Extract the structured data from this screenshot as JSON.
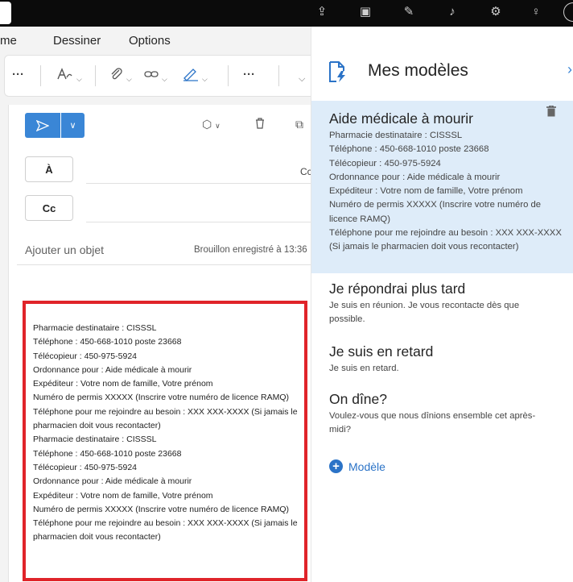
{
  "menu": {
    "home_partial": "me",
    "draw": "Dessiner",
    "options": "Options"
  },
  "ribbon": {
    "more1": "···",
    "more2": "···"
  },
  "compose": {
    "to_label": "À",
    "cc_label": "Cc",
    "cc_right_label": "Cc",
    "subject_placeholder": "Ajouter un objet",
    "draft_status": "Brouillon enregistré à 13:36",
    "body_lines": [
      "Pharmacie destinataire : CISSSL",
      "Téléphone : 450-668-1010 poste 23668",
      "Télécopieur : 450-975-5924",
      "Ordonnance pour : Aide médicale à mourir",
      "Expéditeur : Votre nom de famille, Votre prénom",
      "Numéro de permis XXXXX (Inscrire votre numéro de licence RAMQ)",
      "Téléphone pour me rejoindre au besoin : XXX XXX-XXXX (Si jamais le",
      "pharmacien doit vous recontacter)",
      "Pharmacie destinataire : CISSSL",
      "Téléphone : 450-668-1010 poste 23668",
      "Télécopieur : 450-975-5924",
      "Ordonnance pour : Aide médicale à mourir",
      "Expéditeur : Votre nom de famille, Votre prénom",
      "Numéro de permis XXXXX (Inscrire votre numéro de licence RAMQ)",
      "Téléphone pour me rejoindre au besoin : XXX XXX-XXXX (Si jamais le",
      "pharmacien doit vous recontacter)"
    ]
  },
  "panel": {
    "title": "Mes modèles",
    "close": "›",
    "templates": [
      {
        "title": "Aide médicale à mourir",
        "lines": [
          "Pharmacie destinataire : CISSSL",
          "Téléphone : 450-668-1010 poste 23668",
          "Télécopieur : 450-975-5924",
          "Ordonnance pour : Aide médicale à mourir",
          "Expéditeur : Votre nom de famille, Votre prénom",
          "Numéro de permis XXXXX (Inscrire votre numéro de",
          "licence RAMQ)",
          "Téléphone pour me rejoindre au besoin : XXX XXX-XXXX",
          "(Si jamais le pharmacien doit vous recontacter)"
        ]
      },
      {
        "title": "Je répondrai plus tard",
        "lines": [
          "Je suis en réunion. Je vous recontacte dès que",
          "possible."
        ]
      },
      {
        "title": "Je suis en retard",
        "lines": [
          "Je suis en retard."
        ]
      },
      {
        "title": "On dîne?",
        "lines": [
          "Voulez-vous que nous dînions ensemble cet après-",
          "midi?"
        ]
      }
    ],
    "add_label": "Modèle"
  },
  "colors": {
    "accent": "#3a86d6",
    "selected_bg": "#deecf9",
    "highlight_border": "#e0242a"
  }
}
